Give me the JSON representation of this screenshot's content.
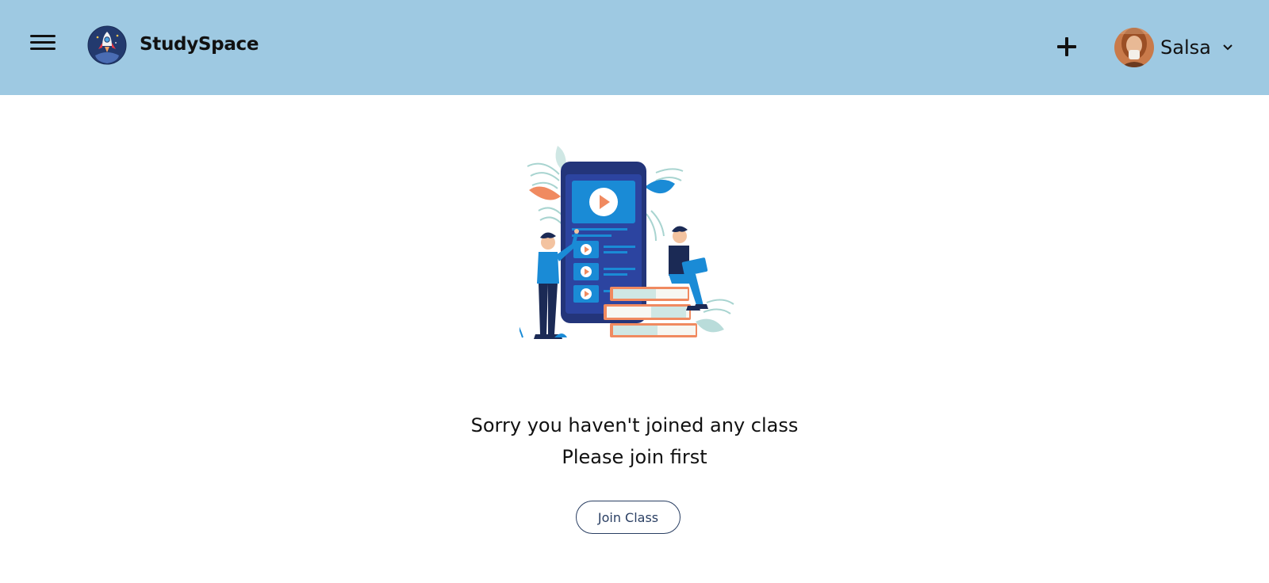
{
  "header": {
    "menu_icon": "hamburger-menu-icon",
    "logo_icon": "rocket-logo-icon",
    "brand": "StudySpace",
    "add_icon": "plus-icon",
    "user": {
      "name": "Salsa",
      "avatar": "user-avatar",
      "dropdown_icon": "chevron-down-icon"
    }
  },
  "main": {
    "illustration": "online-learning-illustration",
    "message_line1": "Sorry you haven't joined any class",
    "message_line2": "Please join first",
    "join_button_label": "Join Class"
  },
  "colors": {
    "header_bg": "#9ec9e2",
    "button_border": "#2a3f63",
    "phone_dark": "#23357a",
    "accent_blue": "#1a8bd6",
    "accent_orange": "#f08a60"
  }
}
